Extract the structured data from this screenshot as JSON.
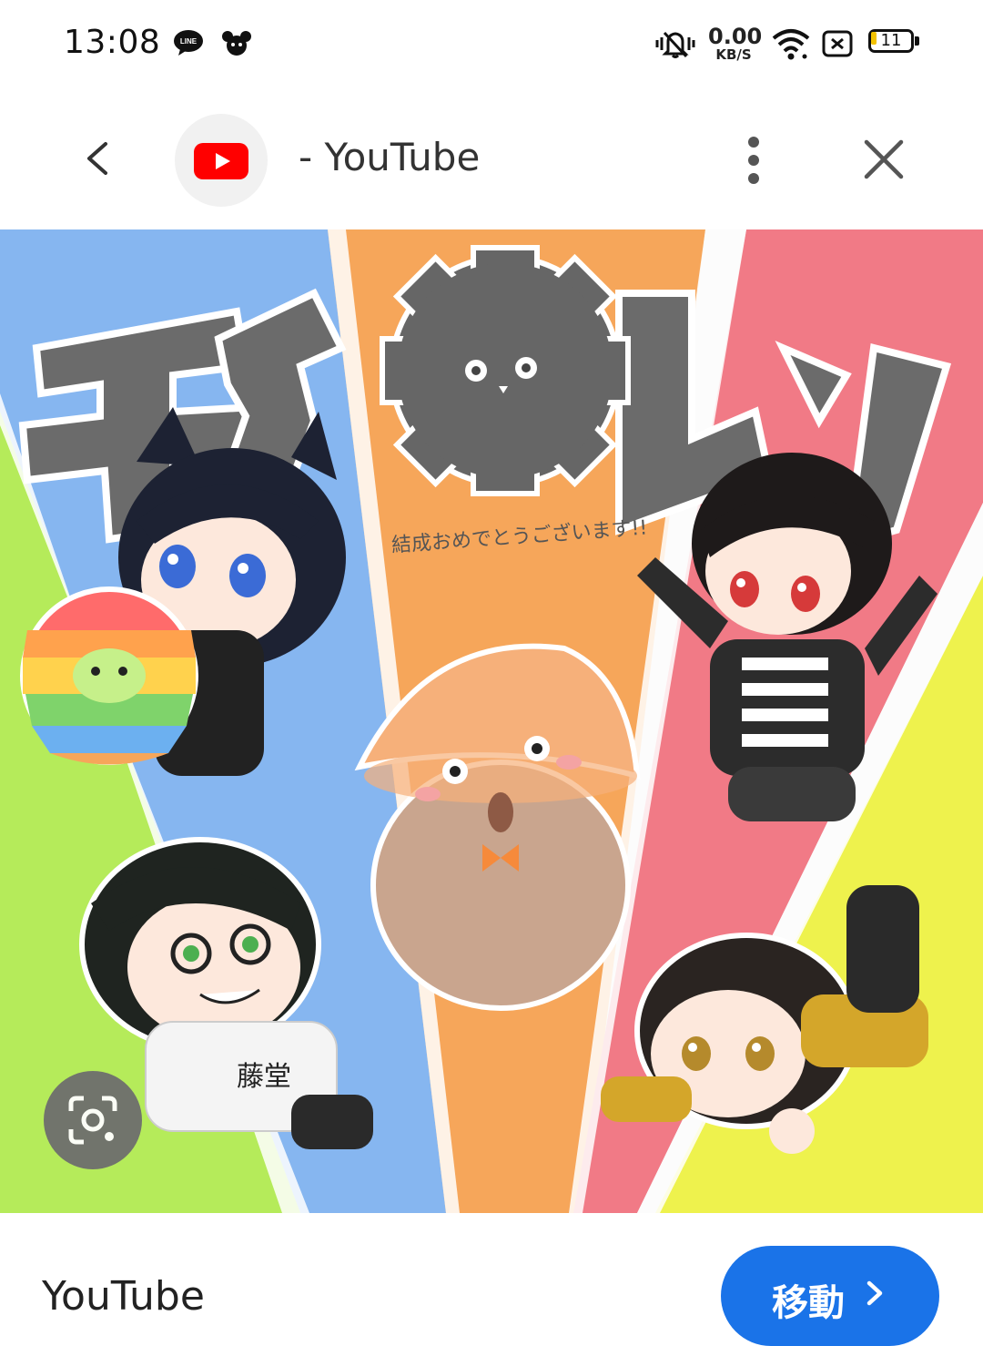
{
  "status_bar": {
    "time": "13:08",
    "net_speed_value": "0.00",
    "net_speed_unit": "KB/S",
    "battery_level": "11",
    "icons": [
      "line-icon",
      "mouse-icon",
      "mute-icon",
      "wifi-icon",
      "sim-icon",
      "battery-icon"
    ]
  },
  "toolbar": {
    "title": "- YouTube",
    "icons": [
      "back-icon",
      "youtube-icon",
      "more-icon",
      "close-icon"
    ]
  },
  "image": {
    "logo_text": "モジ レン",
    "caption": "結成おめでとうございます!!",
    "shirt_text": "藤堂"
  },
  "footer": {
    "site_name": "YouTube",
    "visit_label": "移動",
    "accent_color": "#1a73e8"
  }
}
